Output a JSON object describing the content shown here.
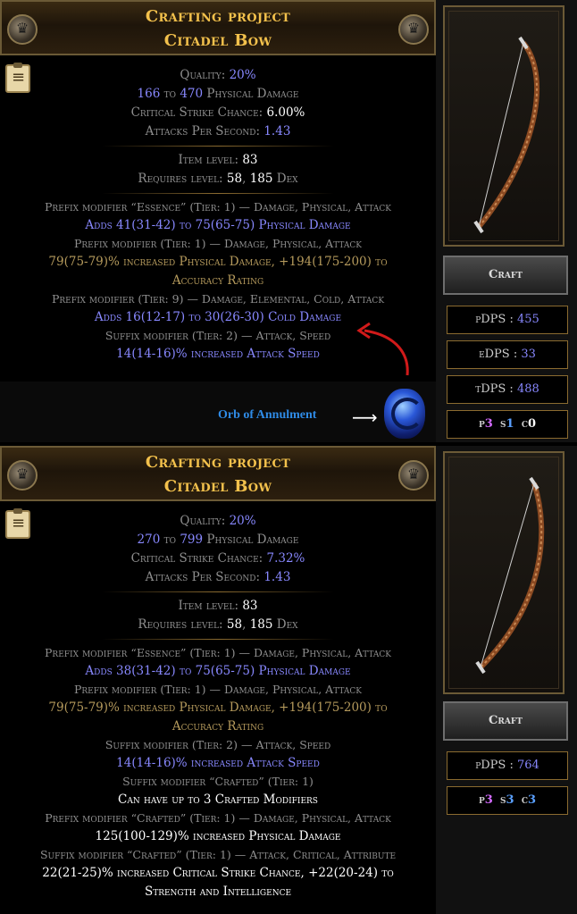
{
  "panel1": {
    "header": {
      "title": "Crafting project",
      "item_name": "Citadel Bow"
    },
    "quality": {
      "label": "Quality:",
      "value": "20%"
    },
    "damage": {
      "min": "166",
      "to": "to",
      "max": "470",
      "label": "Physical Damage"
    },
    "crit": {
      "label": "Critical Strike Chance:",
      "value": "6.00%"
    },
    "aps": {
      "label": "Attacks Per Second:",
      "value": "1.43"
    },
    "ilvl": {
      "label": "Item level:",
      "value": "83"
    },
    "req": {
      "label": "Requires level:",
      "level": "58",
      "dex": "185",
      "dex_label": "Dex"
    },
    "mods": [
      {
        "header": "Prefix modifier “Essence” (Tier: 1) — Damage, Physical, Attack",
        "lines": [
          "Adds 41(31-42) to 75(65-75) Physical Damage"
        ]
      },
      {
        "header": "Prefix modifier (Tier: 1) — Damage, Physical, Attack",
        "lines": [
          "79(75-79)% increased Physical Damage, +194(175-200) to",
          "Accuracy Rating"
        ]
      },
      {
        "header": "Prefix modifier (Tier: 9) — Damage, Elemental, Cold, Attack",
        "lines": [
          "Adds 16(12-17) to 30(26-30) Cold Damage"
        ]
      },
      {
        "header": "Suffix modifier (Tier: 2) — Attack, Speed",
        "lines": [
          "14(14-16)% increased Attack Speed"
        ]
      }
    ],
    "craft_button": "Craft",
    "stats": {
      "pdps": {
        "label": "pDPS :",
        "value": "455"
      },
      "edps": {
        "label": "eDPS :",
        "value": "33"
      },
      "tdps": {
        "label": "tDPS :",
        "value": "488"
      }
    },
    "sockets": {
      "p": "p",
      "p_val": "3",
      "s": "s",
      "s_val": "1",
      "c": "c",
      "c_val": "0"
    },
    "orb_label": "Orb of Annulment",
    "arrow": "⟶"
  },
  "panel2": {
    "header": {
      "title": "Crafting project",
      "item_name": "Citadel Bow"
    },
    "quality": {
      "label": "Quality:",
      "value": "20%"
    },
    "damage": {
      "min": "270",
      "to": "to",
      "max": "799",
      "label": "Physical Damage"
    },
    "crit": {
      "label": "Critical Strike Chance:",
      "value": "7.32%"
    },
    "aps": {
      "label": "Attacks Per Second:",
      "value": "1.43"
    },
    "ilvl": {
      "label": "Item level:",
      "value": "83"
    },
    "req": {
      "label": "Requires level:",
      "level": "58",
      "dex": "185",
      "dex_label": "Dex"
    },
    "mods": [
      {
        "header": "Prefix modifier “Essence” (Tier: 1) — Damage, Physical, Attack",
        "lines": [
          "Adds 38(31-42) to 75(65-75) Physical Damage"
        ]
      },
      {
        "header": "Prefix modifier (Tier: 1) — Damage, Physical, Attack",
        "lines": [
          "79(75-79)% increased Physical Damage, +194(175-200) to",
          "Accuracy Rating"
        ]
      },
      {
        "header": "Suffix modifier (Tier: 2) — Attack, Speed",
        "lines": [
          "14(14-16)% increased Attack Speed"
        ]
      },
      {
        "header": "Suffix modifier “Crafted” (Tier: 1)",
        "lines": [
          "Can have up to 3 Crafted Modifiers"
        ]
      },
      {
        "header": "Prefix modifier “Crafted” (Tier: 1) — Damage, Physical, Attack",
        "lines": [
          "125(100-129)% increased Physical Damage"
        ]
      },
      {
        "header": "Suffix modifier “Crafted” (Tier: 1) — Attack, Critical, Attribute",
        "lines": [
          "22(21-25)% increased Critical Strike Chance, +22(20-24) to",
          "Strength and Intelligence"
        ]
      }
    ],
    "craft_button": "Craft",
    "stats": {
      "pdps": {
        "label": "pDPS :",
        "value": "764"
      }
    },
    "sockets": {
      "p": "p",
      "p_val": "3",
      "s": "s",
      "s_val": "3",
      "c": "c",
      "c_val": "3"
    }
  },
  "colors": {
    "gold": "#f3c14c",
    "magic": "#8888ff",
    "crafted": "#ffffff",
    "gray": "#8f8f8f",
    "orb_text": "#2f8be6",
    "annotation_arrow": "#d11a1a"
  },
  "icons": [
    "medal-icon",
    "clipboard-icon",
    "bow-icon",
    "orb-of-annulment-icon",
    "arrow-right-icon"
  ]
}
